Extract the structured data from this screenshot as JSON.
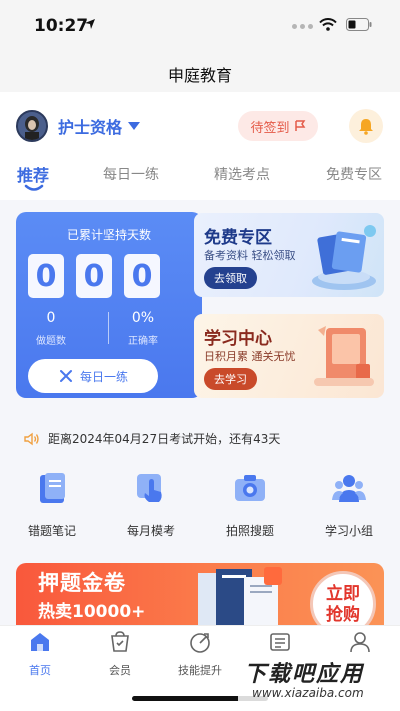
{
  "status_bar": {
    "time": "10:27"
  },
  "nav": {
    "title": "申庭教育"
  },
  "header": {
    "exam": "护士资格",
    "checkin_label": "待签到",
    "tabs": [
      "推荐",
      "每日一练",
      "精选考点",
      "免费专区"
    ]
  },
  "stats": {
    "title": "已累计坚持天数",
    "digits": [
      "0",
      "0",
      "0"
    ],
    "questions_done": "0",
    "questions_label": "做题数",
    "accuracy": "0%",
    "accuracy_label": "正确率",
    "daily_button": "每日一练"
  },
  "promos": [
    {
      "title": "免费专区",
      "subtitle": "备考资料  轻松领取",
      "button": "去领取",
      "accent": "#1e3a8a",
      "button_color": "#24418f"
    },
    {
      "title": "学习中心",
      "subtitle": "日积月累  通关无忧",
      "button": "去学习",
      "accent": "#8a2a1e",
      "button_color": "#c94a2a"
    }
  ],
  "countdown": "距离2024年04月27日考试开始，还有43天",
  "tools": [
    {
      "label": "错题笔记",
      "icon": "notebook-icon"
    },
    {
      "label": "每月模考",
      "icon": "exam-touch-icon"
    },
    {
      "label": "拍照搜题",
      "icon": "camera-icon"
    },
    {
      "label": "学习小组",
      "icon": "group-icon"
    }
  ],
  "banner": {
    "line1": "押题金卷",
    "line2": "热卖10000+",
    "cta_line1": "立即",
    "cta_line2": "抢购"
  },
  "tab_bar": [
    {
      "label": "首页",
      "icon": "home-icon",
      "active": true
    },
    {
      "label": "会员",
      "icon": "member-icon",
      "active": false
    },
    {
      "label": "技能提升",
      "icon": "skill-icon",
      "active": false
    },
    {
      "label": "",
      "icon": "list-icon",
      "active": false
    },
    {
      "label": "",
      "icon": "profile-icon",
      "active": false
    }
  ],
  "watermark": {
    "line1": "下载吧应用",
    "line2": "www.xiazaiba.com"
  },
  "colors": {
    "primary": "#4a78ee",
    "accent_red": "#e45a48",
    "banner": "#f9583c"
  }
}
